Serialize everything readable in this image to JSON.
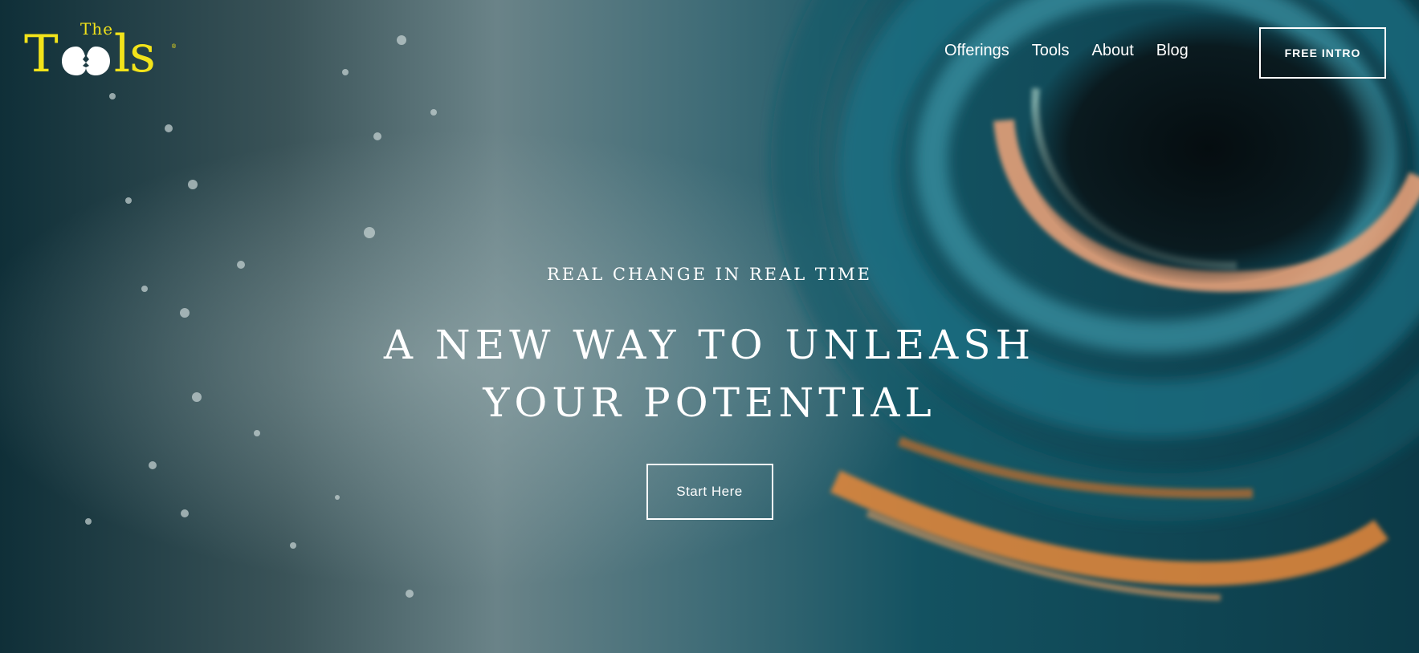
{
  "brand": {
    "small_word": "The",
    "big_word_start": "T",
    "big_word_end": "ls",
    "registered_mark": "®",
    "color": "#f2e31a"
  },
  "nav": {
    "items": [
      {
        "label": "Offerings"
      },
      {
        "label": "Tools"
      },
      {
        "label": "About"
      },
      {
        "label": "Blog"
      }
    ]
  },
  "header": {
    "cta_label": "FREE INTRO"
  },
  "hero": {
    "eyebrow": "REAL CHANGE IN REAL TIME",
    "headline": "A NEW WAY TO UNLEASH YOUR POTENTIAL",
    "button_label": "Start Here"
  },
  "colors": {
    "background_dark": "#0d2a33",
    "teal": "#1f6f84",
    "accent_orange": "#e9883a",
    "accent_peach": "#f1a57a",
    "text": "#ffffff"
  }
}
